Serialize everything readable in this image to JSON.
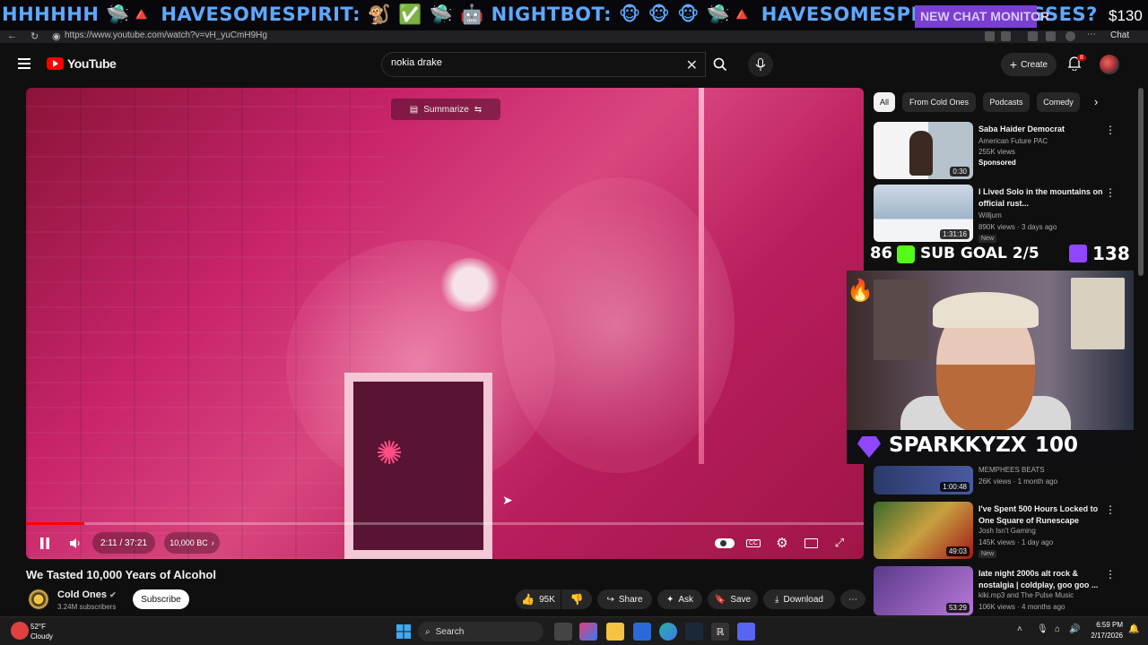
{
  "stream_overlay": {
    "ticker_text": "HHHHHH 🛸🔺 HAVESOMESPIRIT: 🐒 ✅ 🛸 🤖 NIGHTBOT: 🐵 🐵 🐵 🛸🔺 HAVESOMESPIRIT: 5X LOSSES?",
    "ticker_badge": "NEW CHAT MONITOR",
    "ticker_money": "$130",
    "sub_goal_left": "86",
    "sub_goal_label": "SUB GOAL 2/5",
    "sub_goal_right": "138",
    "donor_name": "SPARKKYZX",
    "donor_amount": "100"
  },
  "browser": {
    "url": "https://www.youtube.com/watch?v=vH_yuCmH9Hg",
    "chat_label": "Chat"
  },
  "youtube": {
    "logo_text": "YouTube",
    "search": {
      "value": "nokia drake"
    },
    "create_label": "Create",
    "notification_count": "8"
  },
  "player": {
    "summarize_label": "Summarize",
    "current_time": "2:11 / 37:21",
    "chapter_label": "10,000 BC",
    "progress": 0.07,
    "buffered": 0.09
  },
  "video": {
    "title": "We Tasted 10,000 Years of Alcohol",
    "channel_name": "Cold Ones",
    "subscriber_count": "3.24M subscribers",
    "subscribe_label": "Subscribe",
    "like_count": "95K",
    "share_label": "Share",
    "ask_label": "Ask",
    "save_label": "Save",
    "download_label": "Download"
  },
  "chips": [
    "All",
    "From Cold Ones",
    "Podcasts",
    "Comedy"
  ],
  "recommendations": [
    {
      "title": "Saba Haider Democrat",
      "channel": "American Future PAC",
      "meta": "255K views",
      "badge": "Sponsored",
      "duration": "0:30"
    },
    {
      "title": "I Lived Solo in the mountains on official rust...",
      "channel": "Willjum",
      "meta": "890K views · 3 days ago",
      "badge": "New",
      "duration": "1:31:16"
    },
    {
      "title": "MEMPHEES BEATS",
      "channel": "",
      "meta": "26K views · 1 month ago",
      "badge": "",
      "duration": "1:00:48"
    },
    {
      "title": "I've Spent 500 Hours Locked to One Square of Runescape",
      "channel": "Josh Isn't Gaming",
      "meta": "145K views · 1 day ago",
      "badge": "New",
      "duration": "49:03"
    },
    {
      "title": "late night 2000s alt rock & nostalgia | coldplay, goo goo ...",
      "channel": "kiki.mp3 and The Pulse Music",
      "meta": "106K views · 4 months ago",
      "badge": "",
      "duration": "53:29"
    }
  ],
  "taskbar": {
    "temperature": "52°F",
    "condition": "Cloudy",
    "search_label": "Search",
    "time": "6:59 PM",
    "date": "2/17/2026"
  }
}
